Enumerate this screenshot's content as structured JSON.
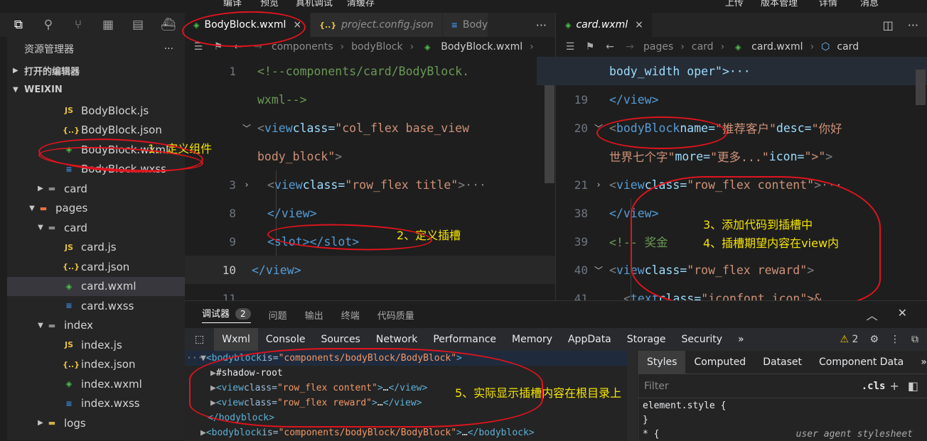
{
  "top_strip": [
    "编译",
    "预览",
    "真机调试",
    "清缓存",
    "上传",
    "版本管理",
    "详情",
    "消息"
  ],
  "activity_icons": [
    "explorer-icon",
    "search-icon",
    "source-control-icon",
    "extensions-icon",
    "storage-icon",
    "docker-icon"
  ],
  "sidebar": {
    "title": "资源管理器",
    "more": "···",
    "open_editors": "打开的编辑器",
    "workspace": "WEIXIN",
    "items": [
      {
        "label": "BodyBlock.js",
        "type": "js",
        "icon": "JS"
      },
      {
        "label": "BodyBlock.json",
        "type": "json",
        "icon": "{..}"
      },
      {
        "label": "BodyBlock.wxml",
        "type": "wxml",
        "icon": "◈"
      },
      {
        "label": "BodyBlock.wxss",
        "type": "wxss",
        "icon": "≡"
      },
      {
        "label": "card",
        "type": "folder",
        "icon": "▬"
      },
      {
        "label": "pages",
        "type": "pagesf",
        "icon": "▬"
      },
      {
        "label": "card",
        "type": "folder",
        "icon": "▬"
      },
      {
        "label": "card.js",
        "type": "js",
        "icon": "JS"
      },
      {
        "label": "card.json",
        "type": "json",
        "icon": "{..}"
      },
      {
        "label": "card.wxml",
        "type": "wxml",
        "icon": "◈"
      },
      {
        "label": "card.wxss",
        "type": "wxss",
        "icon": "≡"
      },
      {
        "label": "index",
        "type": "folder",
        "icon": "▬"
      },
      {
        "label": "index.js",
        "type": "js",
        "icon": "JS"
      },
      {
        "label": "index.json",
        "type": "json",
        "icon": "{..}"
      },
      {
        "label": "index.wxml",
        "type": "wxml",
        "icon": "◈"
      },
      {
        "label": "index.wxss",
        "type": "wxss",
        "icon": "≡"
      },
      {
        "label": "logs",
        "type": "logsf",
        "icon": "▬"
      }
    ]
  },
  "editor1": {
    "tabs": [
      {
        "label": "BodyBlock.wxml",
        "icon": "◈",
        "close": "×"
      },
      {
        "label": "project.config.json",
        "icon": "{..}"
      },
      {
        "label": "Body",
        "icon": "≡"
      }
    ],
    "more": "···",
    "breadcrumb": [
      "components",
      "bodyBlock",
      "BodyBlock.wxml",
      "..."
    ],
    "lines": [
      {
        "n": "1",
        "text1": "<!--components/card/BodyBlock.",
        "text2": "wxml-->"
      },
      {
        "n": "3",
        "pre": "<",
        "tag": "view",
        "attr": " class=",
        "val": "\"row_flex title\"",
        "post": ">···"
      },
      {
        "n": "8",
        "close": "</view>"
      },
      {
        "n": "9",
        "slot": "<slot></slot>"
      },
      {
        "n": "10",
        "close": "</view>"
      },
      {
        "n": "11"
      }
    ],
    "line2_parts": {
      "tag": "view",
      "attr": " class=",
      "val1": "\"col_flex base_view",
      "val2": "body_block\""
    }
  },
  "editor2": {
    "tab": {
      "label": "card.wxml",
      "icon": "◈",
      "close": "×"
    },
    "breadcrumb": [
      "pages",
      "card",
      "card.wxml",
      "card"
    ],
    "lines": {
      "first": "body_width oper\">···",
      "n19": "19",
      "l19": "</view>",
      "n20": "20",
      "l20_tag": "bodyBlock",
      "l20_a1": " name=",
      "l20_v1": "\"推荐客户\"",
      "l20_a2": " desc=",
      "l20_v2": "\"你好",
      "l20b_v2": "世界七个字\"",
      "l20b_a3": " more=",
      "l20b_v3": "\"更多...\"",
      "l20b_a4": " icon=",
      "l20b_v4": "\">\"",
      "n21": "21",
      "l21_attr": " class=",
      "l21_val": "\"row_flex content\"",
      "n38": "38",
      "l38": "</view>",
      "n39": "39",
      "l39": "<!-- 奖金",
      "n40": "40",
      "l40_val": "\"row_flex reward\"",
      "n41": "41",
      "l41_attr": " class=",
      "l41_val": "\"iconfont icon\">&"
    }
  },
  "annotations": {
    "a1": "1、定义组件",
    "a2": "2、定义插槽",
    "a3": "3、添加代码到插槽中",
    "a4": "4、插槽期望内容在view内",
    "a5": "5、实际显示插槽内容在根目录上"
  },
  "panel": {
    "tabs": [
      {
        "label": "调试器",
        "badge": "2"
      },
      {
        "label": "问题"
      },
      {
        "label": "输出"
      },
      {
        "label": "终端"
      },
      {
        "label": "代码质量"
      }
    ],
    "devtools_tabs": [
      "Wxml",
      "Console",
      "Sources",
      "Network",
      "Performance",
      "Memory",
      "AppData",
      "Storage",
      "Security"
    ],
    "chevron": "»",
    "warnings": "2",
    "elements": {
      "l1_tag": "bodyblock",
      "l1_attr": " is=",
      "l1_val": "\"components/bodyBlock/BodyBlock\"",
      "l2": "#shadow-root",
      "l3_val": "\"row_flex content\"",
      "l4_val": "\"row_flex reward\"",
      "l5": "</bodyblock>",
      "l6_val": "\"components/bodyBlock/BodyBlock\""
    },
    "styles_tabs": [
      "Styles",
      "Computed",
      "Dataset",
      "Component Data"
    ],
    "filter_placeholder": "Filter",
    "cls": ".cls",
    "style_lines": [
      "element.style {",
      "}",
      "* {"
    ],
    "ua": "user agent stylesheet"
  }
}
